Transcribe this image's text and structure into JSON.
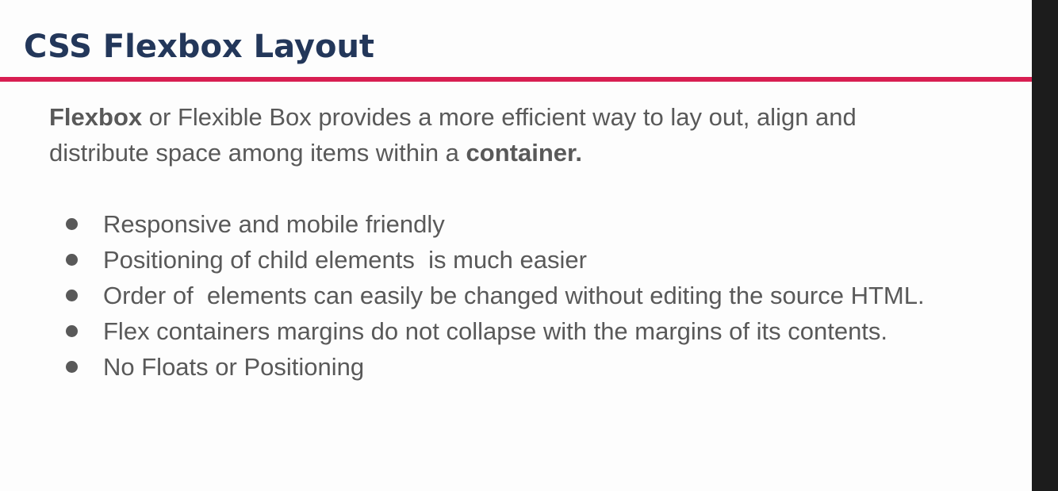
{
  "slide": {
    "title": "CSS Flexbox Layout",
    "intro": {
      "bold_term": "Flexbox",
      "text_middle": " or Flexible Box provides a more efficient way to lay out, align and distribute space among items within a ",
      "bold_end": "container."
    },
    "bullets": [
      "Responsive and mobile friendly",
      "Positioning of child elements  is much easier",
      "Order of  elements can easily be changed without editing the source HTML.",
      "Flex containers margins do not collapse with the margins of its contents.",
      "No Floats or Positioning"
    ]
  },
  "colors": {
    "title": "#23375a",
    "accent_rule": "#d81f52",
    "body_text": "#595959",
    "background": "#fdfdfd",
    "side_bar": "#1c1c1c"
  }
}
